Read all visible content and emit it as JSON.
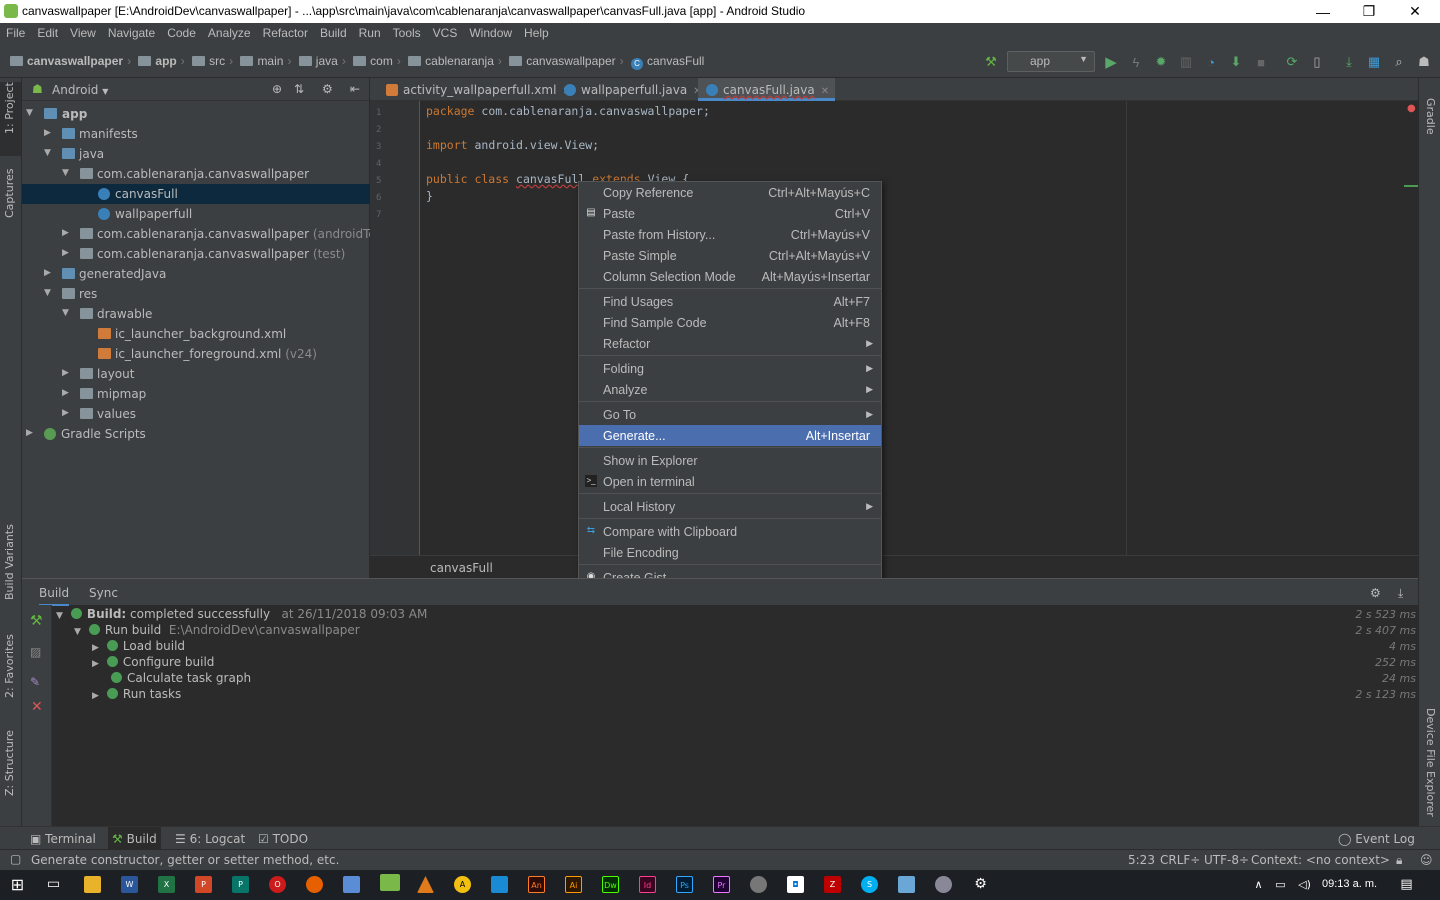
{
  "window": {
    "title": "canvaswallpaper [E:\\AndroidDev\\canvaswallpaper] - ...\\app\\src\\main\\java\\com\\cablenaranja\\canvaswallpaper\\canvasFull.java [app] - Android Studio",
    "minimize": "—",
    "restore": "❐",
    "close": "✕"
  },
  "menu": [
    "File",
    "Edit",
    "View",
    "Navigate",
    "Code",
    "Analyze",
    "Refactor",
    "Build",
    "Run",
    "Tools",
    "VCS",
    "Window",
    "Help"
  ],
  "breadcrumbs": [
    "canvaswallpaper",
    "app",
    "src",
    "main",
    "java",
    "com",
    "cablenaranja",
    "canvaswallpaper",
    "canvasFull"
  ],
  "run_config": "app",
  "project": {
    "view": "Android",
    "tree": [
      {
        "label": "app",
        "extra": ""
      },
      {
        "label": "manifests",
        "extra": ""
      },
      {
        "label": "java",
        "extra": ""
      },
      {
        "label": "com.cablenaranja.canvaswallpaper",
        "extra": ""
      },
      {
        "label": "canvasFull",
        "extra": ""
      },
      {
        "label": "wallpaperfull",
        "extra": ""
      },
      {
        "label": "com.cablenaranja.canvaswallpaper",
        "extra": " (androidTest)"
      },
      {
        "label": "com.cablenaranja.canvaswallpaper",
        "extra": " (test)"
      },
      {
        "label": "generatedJava",
        "extra": ""
      },
      {
        "label": "res",
        "extra": ""
      },
      {
        "label": "drawable",
        "extra": ""
      },
      {
        "label": "ic_launcher_background.xml",
        "extra": ""
      },
      {
        "label": "ic_launcher_foreground.xml",
        "extra": " (v24)"
      },
      {
        "label": "layout",
        "extra": ""
      },
      {
        "label": "mipmap",
        "extra": ""
      },
      {
        "label": "values",
        "extra": ""
      },
      {
        "label": "Gradle Scripts",
        "extra": ""
      }
    ]
  },
  "left_tabs": {
    "project": "1: Project",
    "captures": "Captures",
    "build_variants": "Build Variants",
    "favorites": "2: Favorites",
    "structure": "Z: Structure"
  },
  "right_tabs": {
    "gradle": "Gradle",
    "device": "Device File Explorer"
  },
  "editor": {
    "tabs": [
      "activity_wallpaperfull.xml",
      "wallpaperfull.java",
      "canvasFull.java"
    ],
    "line_numbers": [
      "1",
      "2",
      "3",
      "4",
      "5",
      "6",
      "7"
    ],
    "code": {
      "l1_kw": "package",
      "l1_rest": " com.cablenaranja.canvaswallpaper;",
      "l3_kw": "import",
      "l3_rest": " android.view.View;",
      "l5_kw1": "public class ",
      "l5_name": "canvasFull",
      "l5_kw2": " extends ",
      "l5_rest": "View {",
      "l6": "}"
    },
    "breadcrumb": "canvasFull"
  },
  "context_menu": [
    {
      "label": "Copy Reference",
      "shortcut": "Ctrl+Alt+Mayús+C"
    },
    {
      "label": "Paste",
      "shortcut": "Ctrl+V"
    },
    {
      "label": "Paste from History...",
      "shortcut": "Ctrl+Mayús+V"
    },
    {
      "label": "Paste Simple",
      "shortcut": "Ctrl+Alt+Mayús+V"
    },
    {
      "label": "Column Selection Mode",
      "shortcut": "Alt+Mayús+Insertar"
    },
    {
      "label": "Find Usages",
      "shortcut": "Alt+F7"
    },
    {
      "label": "Find Sample Code",
      "shortcut": "Alt+F8"
    },
    {
      "label": "Refactor",
      "shortcut": ""
    },
    {
      "label": "Folding",
      "shortcut": ""
    },
    {
      "label": "Analyze",
      "shortcut": ""
    },
    {
      "label": "Go To",
      "shortcut": ""
    },
    {
      "label": "Generate...",
      "shortcut": "Alt+Insertar"
    },
    {
      "label": "Show in Explorer",
      "shortcut": ""
    },
    {
      "label": "Open in terminal",
      "shortcut": ""
    },
    {
      "label": "Local History",
      "shortcut": ""
    },
    {
      "label": "Compare with Clipboard",
      "shortcut": ""
    },
    {
      "label": "File Encoding",
      "shortcut": ""
    },
    {
      "label": "Create Gist...",
      "shortcut": ""
    }
  ],
  "build": {
    "tabs": [
      "Build",
      "Sync"
    ],
    "rows": [
      {
        "label": "Build:",
        "label2": " completed successfully",
        "meta": "at 26/11/2018 09:03 AM",
        "time": "2 s 523 ms"
      },
      {
        "label": "Run build",
        "label2": "",
        "meta": "E:\\AndroidDev\\canvaswallpaper",
        "time": "2 s 407 ms"
      },
      {
        "label": "Load build",
        "label2": "",
        "meta": "",
        "time": "4 ms"
      },
      {
        "label": "Configure build",
        "label2": "",
        "meta": "",
        "time": "252 ms"
      },
      {
        "label": "Calculate task graph",
        "label2": "",
        "meta": "",
        "time": "24 ms"
      },
      {
        "label": "Run tasks",
        "label2": "",
        "meta": "",
        "time": "2 s 123 ms"
      }
    ]
  },
  "tool_windows": {
    "terminal": "Terminal",
    "build": "Build",
    "logcat": "6: Logcat",
    "todo": "TODO",
    "event_log": "Event Log"
  },
  "status": {
    "message": "Generate constructor, getter or setter method, etc.",
    "position": "5:23",
    "line_sep": "CRLF÷",
    "encoding": "UTF-8÷",
    "context": "Context: <no context>"
  },
  "taskbar": {
    "clock": "09:13 a. m."
  },
  "colors": {
    "highlight": "#4b6eaf",
    "keyword": "#cc7832",
    "panel": "#3c3f41",
    "editor": "#2b2b2b"
  }
}
